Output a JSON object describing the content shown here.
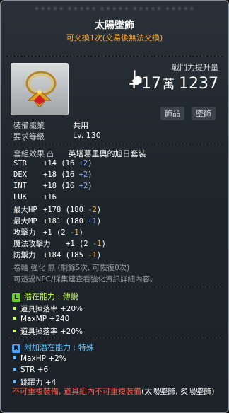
{
  "stars": "★★★★★ ★★★★★ ★★★★★ ★★★★★ ★★★★★",
  "item": {
    "name": "太陽墜飾",
    "tradable": "可交換1次(交易後無法交換)"
  },
  "power": {
    "label": "戰鬥力提升量",
    "arrow": "+",
    "wan": "17",
    "unit": "萬",
    "rest": "1237"
  },
  "categories": [
    "飾品",
    "墜飾"
  ],
  "requirements": [
    {
      "label": "裝備職業",
      "value": "共用"
    },
    {
      "label": "要求等級",
      "value": "Lv. 130"
    }
  ],
  "set": {
    "label": "套組效果",
    "name": "英塔葛里奧的旭日套裝"
  },
  "stats": [
    {
      "label": "STR",
      "base": "+14 (16 ",
      "bonus": "+2",
      "color": "blue",
      "close": ")"
    },
    {
      "label": "DEX",
      "base": "+18 (16 ",
      "bonus": "+2",
      "color": "blue",
      "close": ")"
    },
    {
      "label": "INT",
      "base": "+18 (16 ",
      "bonus": "+2",
      "color": "blue",
      "close": ")"
    },
    {
      "label": "LUK",
      "base": "+16",
      "bonus": "",
      "color": "",
      "close": ""
    },
    {
      "label": "最大HP",
      "base": "+178 (180 ",
      "bonus": "-2",
      "color": "orange",
      "close": ")"
    },
    {
      "label": "最大MP",
      "base": "+181 (180 ",
      "bonus": "+1",
      "color": "blue",
      "close": ")"
    },
    {
      "label": "攻擊力",
      "base": "+1 (2 ",
      "bonus": "-1",
      "color": "orange",
      "close": ")"
    },
    {
      "label": "魔法攻擊力",
      "base": "+1 (2 ",
      "bonus": "-1",
      "color": "orange",
      "close": ")"
    },
    {
      "label": "防禦力",
      "base": "+184 (185 ",
      "bonus": "-1",
      "color": "orange",
      "close": ")"
    }
  ],
  "scroll": "卷軸 強化 無 (剩餘5次, 可恢復0次)",
  "hint": "可透過NPC/採集建查看強化資訊詳細內容。",
  "potential": {
    "head_prefix": "潛在能力 : ",
    "head_rank": "傳說",
    "lines": [
      "道具掉落率 +20%",
      "MaxMP +240",
      "道具掉落率 +20%"
    ]
  },
  "bonus_potential": {
    "head_prefix": "附加潛在能力 : ",
    "head_rank": "特殊",
    "lines": [
      "MaxHP +2%",
      "STR +6",
      "跳躍力 +4"
    ]
  },
  "footer": {
    "red": "不可重複裝備, 道具組內不可重複裝備",
    "white": "(太陽墜飾, 炙陽墜飾)"
  },
  "colors": {
    "accent": "#ffa833",
    "legend": "#c8ff5a",
    "unique": "#5bc0ff",
    "warning": "#ff5a4a"
  }
}
